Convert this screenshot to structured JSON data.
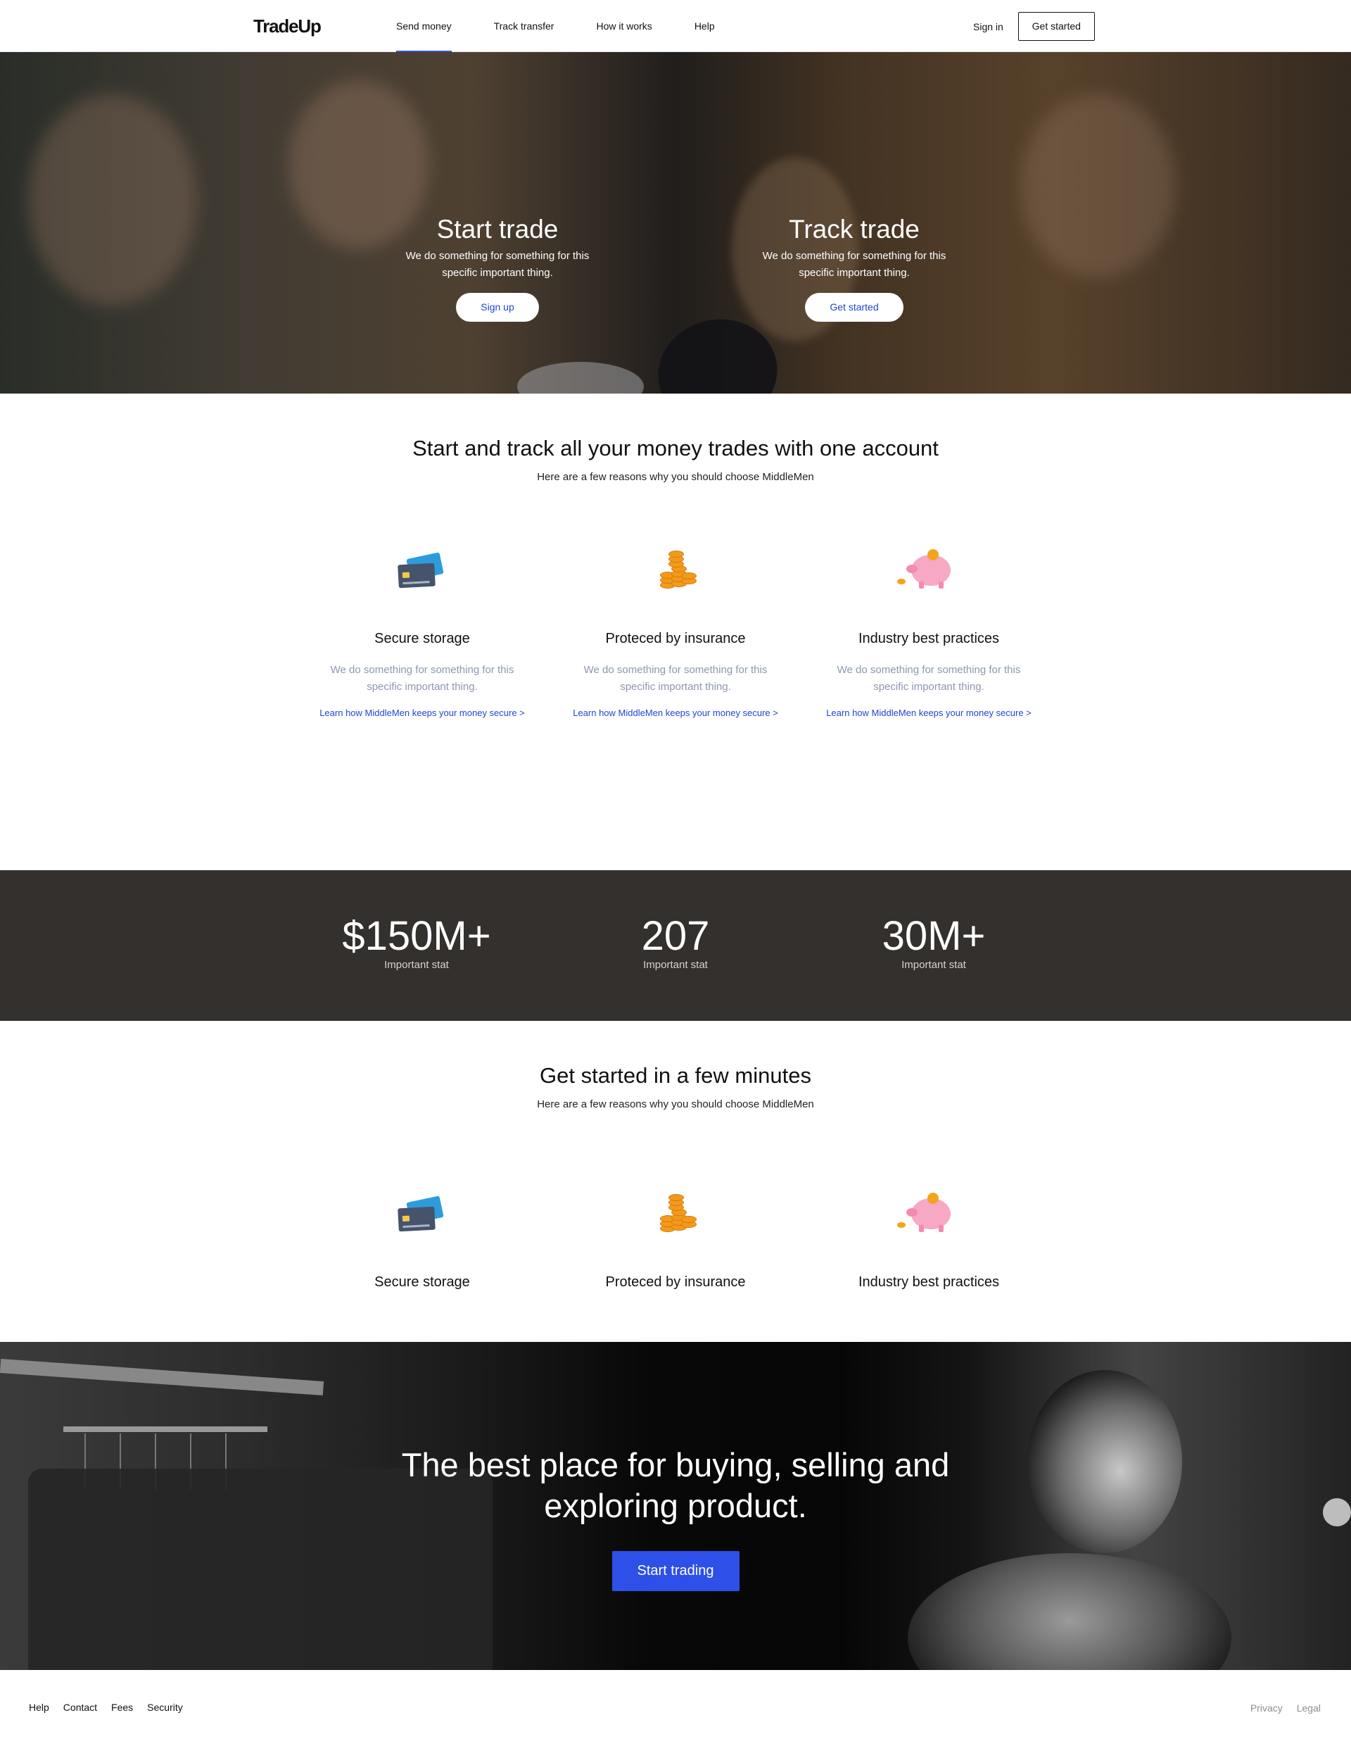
{
  "header": {
    "brand": "TradeUp",
    "nav": [
      "Send money",
      "Track transfer",
      "How it works",
      "Help"
    ],
    "active_nav": "Send money",
    "signin": "Sign in",
    "get_started": "Get started"
  },
  "hero": {
    "left": {
      "title": "Start trade",
      "text": "We do something for something for this specific important thing.",
      "button": "Sign up"
    },
    "right": {
      "title": "Track trade",
      "text": "We do something for something for this specific important thing.",
      "button": "Get started"
    }
  },
  "features_section": {
    "title": "Start and track all your money trades with one account",
    "subtitle": "Here are a few reasons why you should choose MiddleMen",
    "items": [
      {
        "icon": "credit-cards-icon",
        "title": "Secure storage",
        "text": "We do something for something for this specific important thing.",
        "link": "Learn how MiddleMen keeps your money secure >"
      },
      {
        "icon": "coin-stack-icon",
        "title": "Proteced by insurance",
        "text": "We do something for something for this specific important thing.",
        "link": "Learn how MiddleMen keeps your money secure >"
      },
      {
        "icon": "piggy-bank-icon",
        "title": "Industry best practices",
        "text": "We do something for something for this specific important thing.",
        "link": "Learn how MiddleMen keeps your money secure >"
      }
    ]
  },
  "stats": [
    {
      "value": "$150M+",
      "label": "Important stat"
    },
    {
      "value": "207",
      "label": "Important stat"
    },
    {
      "value": "30M+",
      "label": "Important stat"
    }
  ],
  "get_started_section": {
    "title": "Get started in a few minutes",
    "subtitle": "Here are a few reasons why you should choose MiddleMen",
    "items": [
      {
        "icon": "credit-cards-icon",
        "title": "Secure storage"
      },
      {
        "icon": "coin-stack-icon",
        "title": "Proteced by insurance"
      },
      {
        "icon": "piggy-bank-icon",
        "title": "Industry best practices"
      }
    ]
  },
  "cta": {
    "title_line1": "The best place for buying, selling and",
    "title_line2": "exploring product.",
    "button": "Start trading"
  },
  "footer": {
    "left": [
      "Help",
      "Contact",
      "Fees",
      "Security"
    ],
    "right": [
      "Privacy",
      "Legal"
    ]
  },
  "colors": {
    "accent": "#2e4fe8",
    "link": "#2244d6",
    "stats_bg": "#33302d",
    "muted_text": "#8d97ad"
  }
}
